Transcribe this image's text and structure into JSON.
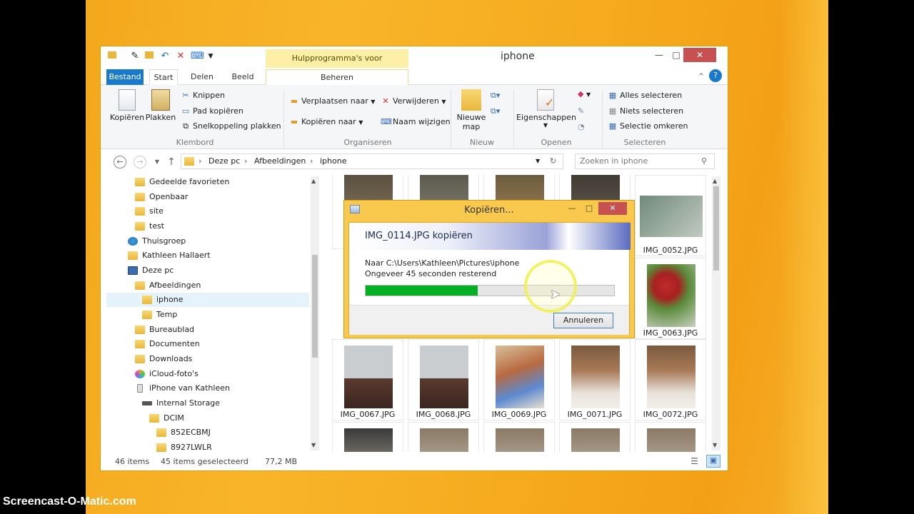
{
  "window": {
    "title": "iphone",
    "contextual_tab_label": "Hulpprogramma's voor afbeeldingen",
    "controls": [
      "_",
      "□",
      "✕"
    ]
  },
  "tabs": {
    "file": "Bestand",
    "start": "Start",
    "share": "Delen",
    "view": "Beeld",
    "manage": "Beheren"
  },
  "ribbon": {
    "clipboard": {
      "label": "Klembord",
      "copy": "Kopiëren",
      "paste": "Plakken",
      "cut": "Knippen",
      "copy_path": "Pad kopiëren",
      "paste_shortcut": "Snelkoppeling plakken"
    },
    "organize": {
      "label": "Organiseren",
      "move_to": "Verplaatsen naar",
      "copy_to": "Kopiëren naar",
      "delete": "Verwijderen",
      "rename": "Naam wijzigen"
    },
    "new": {
      "label": "Nieuw",
      "new_folder_line1": "Nieuwe",
      "new_folder_line2": "map"
    },
    "open": {
      "label": "Openen",
      "properties": "Eigenschappen"
    },
    "select": {
      "label": "Selecteren",
      "select_all": "Alles selecteren",
      "select_none": "Niets selecteren",
      "invert": "Selectie omkeren"
    }
  },
  "address": {
    "crumbs": [
      "Deze pc",
      "Afbeeldingen",
      "iphone"
    ],
    "search_placeholder": "Zoeken in iphone"
  },
  "nav_tree": [
    {
      "label": "Gedeelde favorieten",
      "icon": "folder-icon"
    },
    {
      "label": "Openbaar",
      "icon": "folder-icon"
    },
    {
      "label": "site",
      "icon": "folder-icon"
    },
    {
      "label": "test",
      "icon": "folder-icon"
    },
    {
      "label": "Thuisgroep",
      "icon": "homegroup-icon"
    },
    {
      "label": "Kathleen Hallaert",
      "icon": "user-folder-icon"
    },
    {
      "label": "Deze pc",
      "icon": "computer-icon"
    },
    {
      "label": "Afbeeldingen",
      "icon": "folder-icon"
    },
    {
      "label": "iphone",
      "icon": "folder-icon"
    },
    {
      "label": "Temp",
      "icon": "folder-icon"
    },
    {
      "label": "Bureaublad",
      "icon": "folder-icon"
    },
    {
      "label": "Documenten",
      "icon": "folder-icon"
    },
    {
      "label": "Downloads",
      "icon": "folder-icon"
    },
    {
      "label": "iCloud-foto's",
      "icon": "icloud-icon"
    },
    {
      "label": "iPhone van Kathleen",
      "icon": "phone-icon"
    },
    {
      "label": "Internal Storage",
      "icon": "drive-icon"
    },
    {
      "label": "DCIM",
      "icon": "folder-icon"
    },
    {
      "label": "852ECBMJ",
      "icon": "folder-icon"
    },
    {
      "label": "8927LWLR",
      "icon": "folder-icon"
    }
  ],
  "files": [
    {
      "name": "",
      "colors": [
        "#5a5040",
        "#8a7d62"
      ]
    },
    {
      "name": "",
      "colors": [
        "#5c5a4e",
        "#8e8a7c"
      ]
    },
    {
      "name": "",
      "colors": [
        "#6a5b3e",
        "#b08a5a"
      ]
    },
    {
      "name": "",
      "colors": [
        "#3f3a33",
        "#6e6558"
      ]
    },
    {
      "name": "IMG_0052.JPG",
      "colors": [
        "#6f8b7c",
        "#c2c9c0"
      ]
    },
    {
      "name": "IMG_0063.JPG",
      "colors": [
        "#c02b2b",
        "#5a8a3a"
      ]
    },
    {
      "name": "IMG_0067.JPG",
      "colors": [
        "#c9cdd0",
        "#5a3a2e"
      ]
    },
    {
      "name": "IMG_0068.JPG",
      "colors": [
        "#c9cdd0",
        "#5a3a2e"
      ]
    },
    {
      "name": "IMG_0069.JPG",
      "colors": [
        "#d8c09a",
        "#5c8ad0"
      ]
    },
    {
      "name": "IMG_0071.JPG",
      "colors": [
        "#7a5a3e",
        "#e8e2da"
      ]
    },
    {
      "name": "IMG_0072.JPG",
      "colors": [
        "#7a5a3e",
        "#e8e2da"
      ]
    },
    {
      "name": "",
      "colors": [
        "#3a3a3a",
        "#b8b0a0"
      ]
    },
    {
      "name": "",
      "colors": [
        "#8a7a66",
        "#cfc6b8"
      ]
    },
    {
      "name": "",
      "colors": [
        "#8a7a66",
        "#cfc6b8"
      ]
    },
    {
      "name": "",
      "colors": [
        "#8a7a66",
        "#cfc6b8"
      ]
    },
    {
      "name": "",
      "colors": [
        "#8a7a66",
        "#cfc6b8"
      ]
    }
  ],
  "status": {
    "count": "46 items",
    "selection": "45 items geselecteerd",
    "size": "77,2 MB"
  },
  "dialog": {
    "title": "Kopiëren...",
    "heading": "IMG_0114.JPG kopiëren",
    "destination": "Naar C:\\Users\\Kathleen\\Pictures\\iphone",
    "remaining": "Ongeveer 45 seconden resterend",
    "progress_percent": 45,
    "cancel_label": "Annuleren"
  },
  "watermark": "Screencast-O-Matic.com"
}
